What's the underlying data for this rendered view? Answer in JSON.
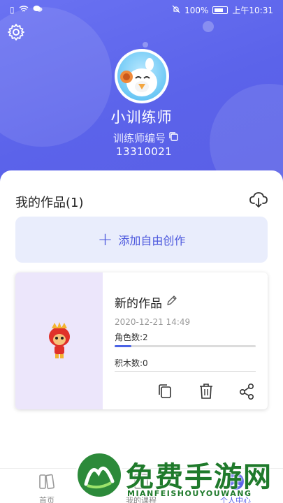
{
  "status": {
    "battery": "100%",
    "time": "上午10:31"
  },
  "profile": {
    "name": "小训练师",
    "id_label": "训练师编号",
    "id_value": "13310021"
  },
  "works": {
    "title": "我的作品(1)",
    "add_label": "添加自由创作",
    "items": [
      {
        "name": "新的作品",
        "date": "2020-12-21 14:49",
        "roles_text": "角色数:2",
        "roles_progress": 0.12,
        "blocks_text": "积木数:0"
      }
    ]
  },
  "tabbar": [
    {
      "label": "首页"
    },
    {
      "label": "我的课程"
    },
    {
      "label": "个人中心"
    }
  ],
  "watermark": {
    "text": "免费手游网",
    "sub": "MIANFEISHOUYOUWANG"
  },
  "colors": {
    "header": "#5b63ea",
    "accent": "#4b57dd",
    "add_bg": "#e9edfc",
    "thumb_bg": "#ece6fb"
  }
}
